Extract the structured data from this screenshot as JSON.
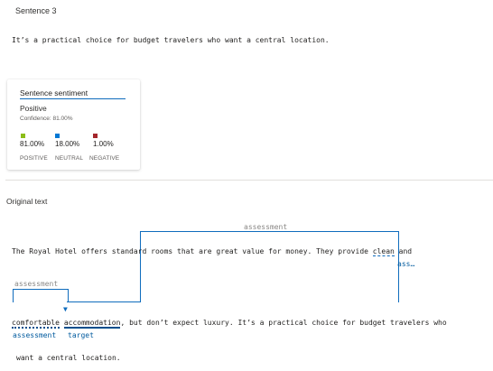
{
  "sentence": {
    "heading": "Sentence 3",
    "text": "It’s a practical choice for budget travelers who want a central location."
  },
  "sentiment_card": {
    "title": "Sentence sentiment",
    "label": "Positive",
    "confidence": "Confidence: 81.00%",
    "scores": [
      {
        "value": "81.00%",
        "category": "POSITIVE",
        "color": "#8cbd18"
      },
      {
        "value": "18.00%",
        "category": "NEUTRAL",
        "color": "#0078d4"
      },
      {
        "value": "1.00%",
        "category": "NEGATIVE",
        "color": "#a4262c"
      }
    ]
  },
  "original": {
    "heading": "Original text",
    "line1": {
      "before": "The Royal Hotel offers standard rooms that are great value for money. They provide ",
      "target": "clean",
      "after": " and",
      "target_tag": "ass…"
    },
    "line2": {
      "word1": "comfortable",
      "space": " ",
      "word2": "accommodation",
      "after": ", but don’t expect luxury. It’s a practical choice for budget travelers who",
      "tag1": "assessment",
      "tag2": "target"
    },
    "line3": "want a central location.",
    "relation_label_top": "assessment",
    "relation_label_left": "assessment"
  }
}
